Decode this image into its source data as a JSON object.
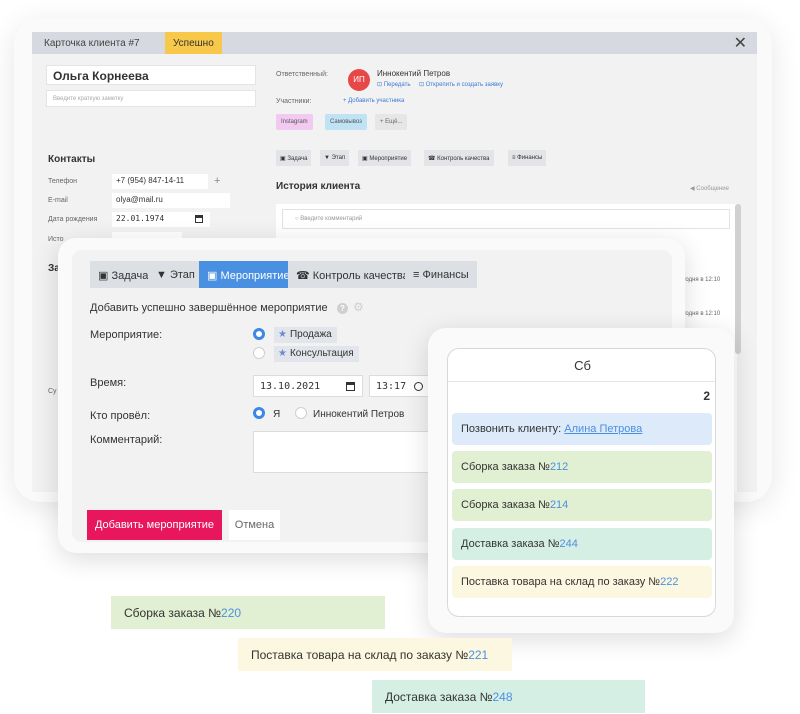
{
  "client_card": {
    "title": "Карточка клиента #7",
    "status": "Успешно",
    "name": "Ольга Корнеева",
    "note_placeholder": "Введите краткую заметку",
    "responsible_label": "Ответственный:",
    "responsible_initials": "ИП",
    "responsible_name": "Иннокентий Петров",
    "transfer_link": "Передать",
    "unpin_link": "Открепить и создать заявку",
    "participants_label": "Участники:",
    "add_participant": "Добавить участника",
    "tags": [
      "Instagram",
      "Самовывоз",
      "Ещё..."
    ],
    "contacts_title": "Контакты",
    "phone_label": "Телефон",
    "phone": "+7 (954) 847-14-11",
    "email_label": "E-mail",
    "email": "olya@mail.ru",
    "birth_label": "Дата рождения",
    "birth": "22.01.1974",
    "source_label": "Исто",
    "section_z": "За",
    "section_su": "Су",
    "tabs": [
      "Задача",
      "Этап",
      "Мероприятие",
      "Контроль качества",
      "Финансы"
    ],
    "history_title": "История клиента",
    "message_link": "Сообщение",
    "comment_placeholder": "Введите комментарий",
    "time_1": "егодня в 12:10",
    "time_2": "егодня в 12:10"
  },
  "event_modal": {
    "tabs": [
      "Задача",
      "Этап",
      "Мероприятие",
      "Контроль качества",
      "Финансы"
    ],
    "active_tab": "Мероприятие",
    "title": "Добавить успешно завершённое мероприятие",
    "event_label": "Мероприятие:",
    "event_options": [
      "Продажа",
      "Консультация"
    ],
    "selected_event": "Продажа",
    "time_label": "Время:",
    "date": "13.10.2021",
    "time": "13:17",
    "who_label": "Кто провёл:",
    "who_options": [
      "Я",
      "Иннокентий Петров"
    ],
    "selected_who": "Я",
    "comment_label": "Комментарий:",
    "submit": "Добавить мероприятие",
    "cancel": "Отмена"
  },
  "calendar_day": {
    "weekday": "Сб",
    "day": "2",
    "events": [
      {
        "text": "Позвонить клиенту: ",
        "link": "Алина Петрова",
        "color": "#ddeaf9"
      },
      {
        "text": "Сборка заказа №",
        "number": "212",
        "color": "#e1efd2"
      },
      {
        "text": "Сборка заказа №",
        "number": "214",
        "color": "#e1efd2"
      },
      {
        "text": "Доставка заказа №",
        "number": "244",
        "color": "#d6efe4"
      },
      {
        "text": "Поставка товара на склад по заказу №",
        "number": "222",
        "color": "#fbf7e0"
      }
    ]
  },
  "floating_cards": [
    {
      "text": "Сборка заказа №",
      "number": "220",
      "color": "#e1efd2"
    },
    {
      "text": "Поставка товара на склад по заказу №",
      "number": "221",
      "color": "#fbf7e0"
    },
    {
      "text": "Доставка заказа №",
      "number": "248",
      "color": "#d6efe4"
    }
  ],
  "colors": {
    "accent_blue": "#4a90e2",
    "submit_pink": "#e8175d",
    "status_yellow": "#f8c84a",
    "avatar_red": "#e84747"
  }
}
